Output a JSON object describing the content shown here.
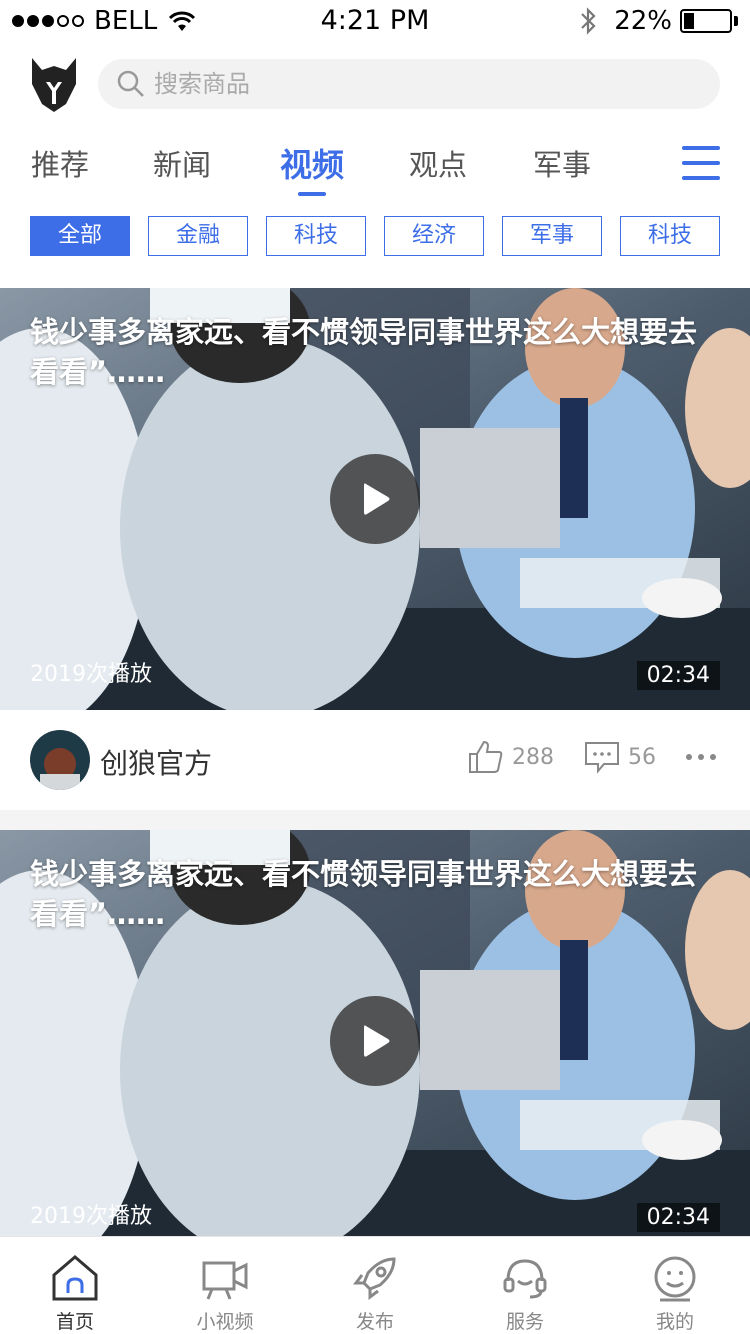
{
  "status_bar": {
    "carrier": "BELL",
    "time": "4:21 PM",
    "battery": "22%",
    "battery_level": 0.22
  },
  "search": {
    "placeholder": "搜索商品",
    "icon": "search-icon"
  },
  "tabs": [
    {
      "label": "推荐",
      "active": false
    },
    {
      "label": "新闻",
      "active": false
    },
    {
      "label": "视频",
      "active": true
    },
    {
      "label": "观点",
      "active": false
    },
    {
      "label": "军事",
      "active": false
    }
  ],
  "chips": [
    {
      "label": "全部",
      "active": true
    },
    {
      "label": "金融",
      "active": false
    },
    {
      "label": "科技",
      "active": false
    },
    {
      "label": "经济",
      "active": false
    },
    {
      "label": "军事",
      "active": false
    },
    {
      "label": "科技",
      "active": false
    }
  ],
  "videos": [
    {
      "title": "钱少事多离家远、看不惯领导同事世界这么大想要去看看”……",
      "plays": "2019次播放",
      "duration": "02:34",
      "author": "创狼官方",
      "likes": "288",
      "comments": "56"
    },
    {
      "title": "钱少事多离家远、看不惯领导同事世界这么大想要去看看”……",
      "plays": "2019次播放",
      "duration": "02:34"
    }
  ],
  "bottom_nav": [
    {
      "label": "首页",
      "icon": "home-icon",
      "active": true
    },
    {
      "label": "小视频",
      "icon": "video-camera-icon",
      "active": false
    },
    {
      "label": "发布",
      "icon": "rocket-icon",
      "active": false
    },
    {
      "label": "服务",
      "icon": "headset-icon",
      "active": false
    },
    {
      "label": "我的",
      "icon": "smiley-icon",
      "active": false
    }
  ],
  "colors": {
    "accent": "#3d6ee8",
    "text": "#333333",
    "muted": "#999999"
  }
}
